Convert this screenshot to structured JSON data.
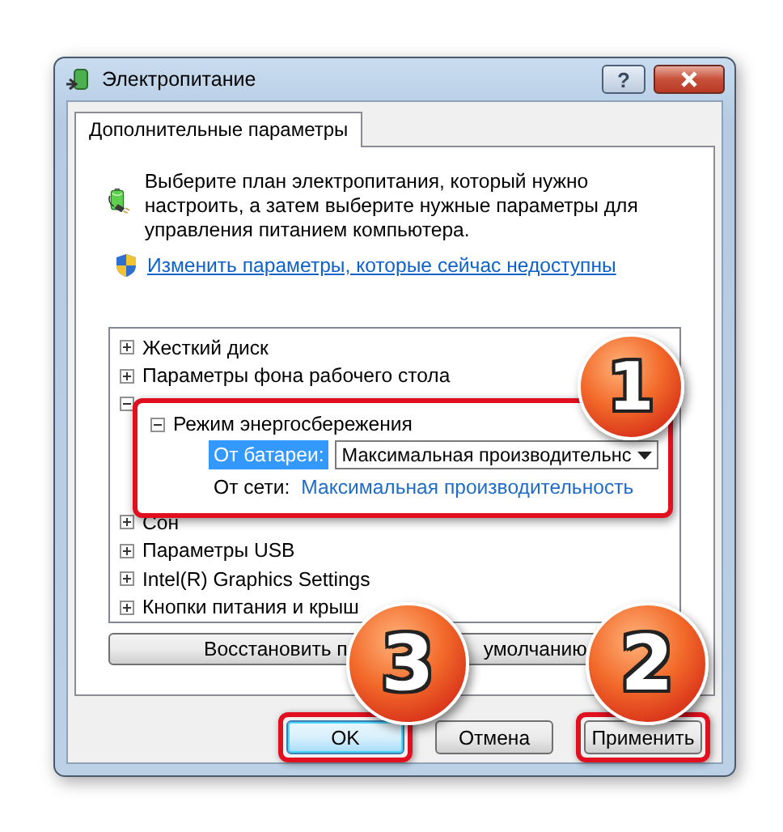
{
  "window": {
    "title": "Электропитание",
    "help_button": "?"
  },
  "tabs": [
    {
      "label": "Дополнительные параметры",
      "selected": true
    }
  ],
  "intro": {
    "text": "Выберите план электропитания, который нужно настроить, а затем выберите нужные параметры для управления питанием компьютера.",
    "link": "Изменить параметры, которые сейчас недоступны"
  },
  "tree": [
    {
      "label": "Жесткий диск",
      "expanded": false
    },
    {
      "label": "Параметры фона рабочего стола",
      "expanded": false
    },
    {
      "expanded": true,
      "children": [
        {
          "label": "Режим энергосбережения",
          "expanded": true,
          "highlighted": true,
          "settings": [
            {
              "label": "От батареи:",
              "kind": "dropdown",
              "value": "Максимальная производительнс",
              "selected": true
            },
            {
              "label": "От сети:",
              "kind": "link",
              "value": "Максимальная производительность",
              "selected": false
            }
          ]
        }
      ]
    },
    {
      "label": "Сон",
      "expanded": false
    },
    {
      "label": "Параметры USB",
      "expanded": false
    },
    {
      "label": "Intel(R) Graphics Settings",
      "expanded": false
    },
    {
      "label": "Кнопки питания и крыш",
      "expanded": false
    }
  ],
  "restore_button": {
    "label_start": "Восстановить п",
    "label_end": "умолчанию"
  },
  "buttons": [
    {
      "label": "OK",
      "default": true,
      "highlighted": true
    },
    {
      "label": "Отмена",
      "default": false,
      "highlighted": false
    },
    {
      "label": "Применить",
      "default": false,
      "highlighted": true
    }
  ],
  "callouts": [
    {
      "number": "1"
    },
    {
      "number": "2"
    },
    {
      "number": "3"
    }
  ]
}
